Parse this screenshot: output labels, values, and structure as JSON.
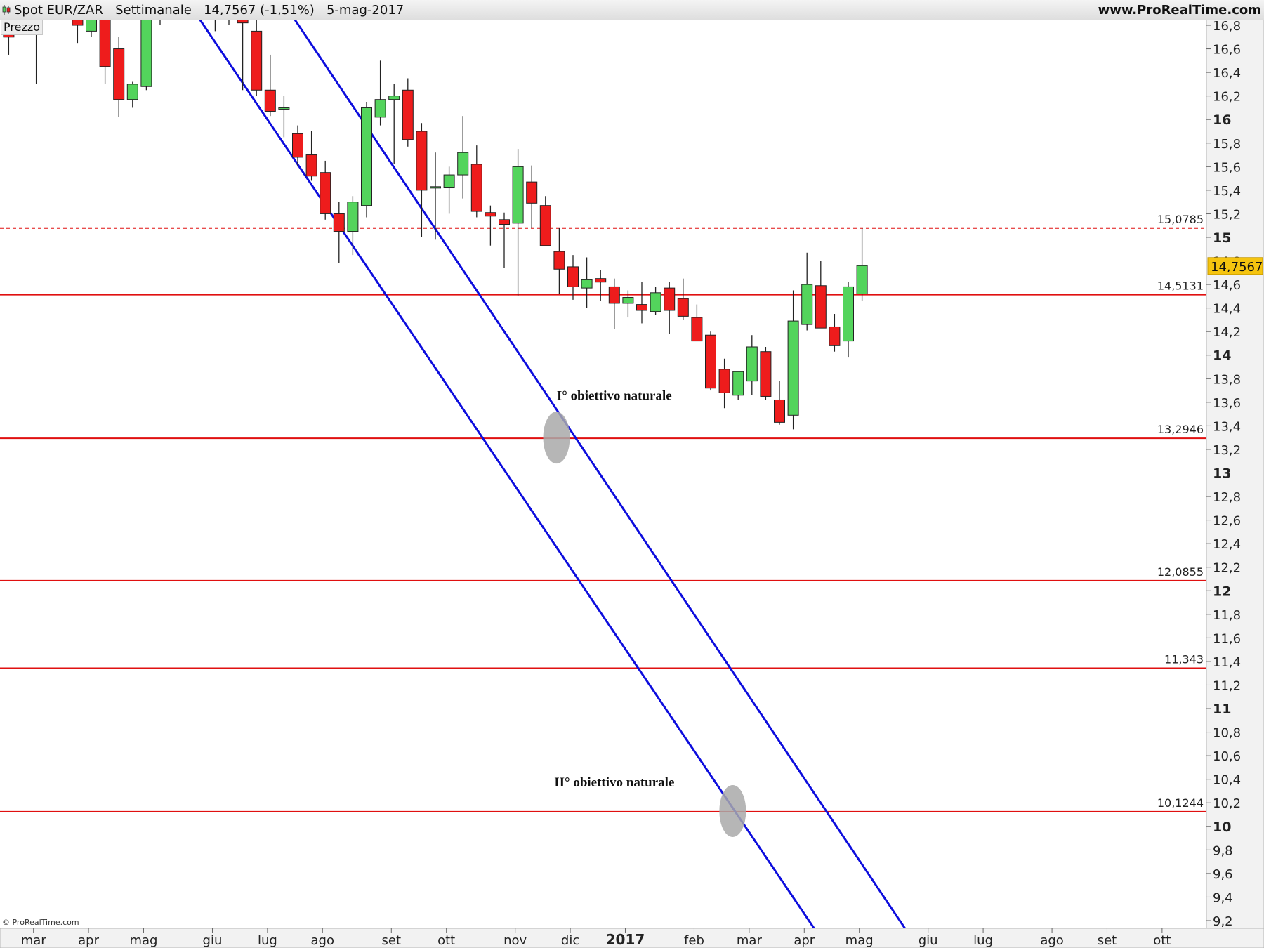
{
  "header": {
    "title": "Spot EUR/ZAR   Settimanale   14,7567 (-1,51%)   5-mag-2017",
    "site": "www.ProRealTime.com"
  },
  "panel": {
    "label": "Prezzo"
  },
  "footer": {
    "credit": "© ProRealTime.com"
  },
  "colors": {
    "up": "#53d45c",
    "down": "#ee1c1c",
    "trend": "#0d0ddd",
    "level": "#e01010",
    "target": "#a9a9a9",
    "price_tag": "#f5c40f",
    "axis_bg": "#f2f2f2"
  },
  "chart_data": {
    "type": "candlestick",
    "timeframe": "Settimanale",
    "ylim": [
      9.1,
      16.9
    ],
    "x_months": [
      {
        "label": "mar",
        "week": 1.8
      },
      {
        "label": "apr",
        "week": 5.8
      },
      {
        "label": "mag",
        "week": 9.8
      },
      {
        "label": "giu",
        "week": 14.8
      },
      {
        "label": "lug",
        "week": 18.8
      },
      {
        "label": "ago",
        "week": 22.8
      },
      {
        "label": "set",
        "week": 27.8
      },
      {
        "label": "ott",
        "week": 31.8
      },
      {
        "label": "nov",
        "week": 36.8
      },
      {
        "label": "dic",
        "week": 40.8
      },
      {
        "label": "2017",
        "week": 44.8,
        "bold": true
      },
      {
        "label": "feb",
        "week": 49.8
      },
      {
        "label": "mar",
        "week": 53.8
      },
      {
        "label": "apr",
        "week": 57.8
      },
      {
        "label": "mag",
        "week": 61.8
      },
      {
        "label": "giu",
        "week": 66.8
      },
      {
        "label": "lug",
        "week": 70.8
      },
      {
        "label": "ago",
        "week": 75.8
      },
      {
        "label": "set",
        "week": 79.8
      },
      {
        "label": "ott",
        "week": 83.8
      }
    ],
    "y_ticks": [
      "16,8",
      "16,6",
      "16,4",
      "16,2",
      "16",
      "15,8",
      "15,6",
      "15,4",
      "15,2",
      "15",
      "14,8",
      "14,6",
      "14,4",
      "14,2",
      "14",
      "13,8",
      "13,6",
      "13,4",
      "13,2",
      "13",
      "12,8",
      "12,6",
      "12,4",
      "12,2",
      "12",
      "11,8",
      "11,6",
      "11,4",
      "11,2",
      "11",
      "10,8",
      "10,6",
      "10,4",
      "10,2",
      "10",
      "9,8",
      "9,6",
      "9,4",
      "9,2"
    ],
    "y_ticks_bold": [
      "16",
      "15",
      "14",
      "13",
      "12",
      "11",
      "10"
    ],
    "candles": [
      {
        "w": 0,
        "o": 16.75,
        "h": 16.9,
        "l": 16.55,
        "c": 16.7
      },
      {
        "w": 2,
        "o": 16.8,
        "h": 16.9,
        "l": 16.3,
        "c": 16.85
      },
      {
        "w": 5,
        "o": 16.9,
        "h": 16.95,
        "l": 16.65,
        "c": 16.8
      },
      {
        "w": 6,
        "o": 16.75,
        "h": 16.92,
        "l": 16.7,
        "c": 16.9
      },
      {
        "w": 7,
        "o": 16.9,
        "h": 16.95,
        "l": 16.3,
        "c": 16.45
      },
      {
        "w": 8,
        "o": 16.6,
        "h": 16.7,
        "l": 16.02,
        "c": 16.17
      },
      {
        "w": 9,
        "o": 16.17,
        "h": 16.32,
        "l": 16.1,
        "c": 16.3
      },
      {
        "w": 10,
        "o": 16.28,
        "h": 16.95,
        "l": 16.25,
        "c": 16.9
      },
      {
        "w": 11,
        "o": 16.9,
        "h": 16.95,
        "l": 16.8,
        "c": 16.92
      },
      {
        "w": 15,
        "o": 16.9,
        "h": 16.95,
        "l": 16.75,
        "c": 16.92
      },
      {
        "w": 16,
        "o": 16.85,
        "h": 16.95,
        "l": 16.8,
        "c": 16.9
      },
      {
        "w": 17,
        "o": 16.95,
        "h": 16.95,
        "l": 16.25,
        "c": 16.82
      },
      {
        "w": 18,
        "o": 16.75,
        "h": 16.85,
        "l": 16.2,
        "c": 16.25
      },
      {
        "w": 19,
        "o": 16.25,
        "h": 16.55,
        "l": 16.03,
        "c": 16.07
      },
      {
        "w": 20,
        "o": 16.1,
        "h": 16.2,
        "l": 15.85,
        "c": 16.1
      },
      {
        "w": 21,
        "o": 15.88,
        "h": 15.95,
        "l": 15.6,
        "c": 15.68
      },
      {
        "w": 22,
        "o": 15.7,
        "h": 15.9,
        "l": 15.48,
        "c": 15.52
      },
      {
        "w": 23,
        "o": 15.55,
        "h": 15.65,
        "l": 15.15,
        "c": 15.2
      },
      {
        "w": 24,
        "o": 15.2,
        "h": 15.3,
        "l": 14.78,
        "c": 15.05
      },
      {
        "w": 25,
        "o": 15.05,
        "h": 15.35,
        "l": 14.85,
        "c": 15.3
      },
      {
        "w": 26,
        "o": 15.27,
        "h": 16.15,
        "l": 15.17,
        "c": 16.1
      },
      {
        "w": 27,
        "o": 16.02,
        "h": 16.5,
        "l": 15.95,
        "c": 16.17
      },
      {
        "w": 28,
        "o": 16.17,
        "h": 16.3,
        "l": 15.62,
        "c": 16.2
      },
      {
        "w": 29,
        "o": 16.25,
        "h": 16.35,
        "l": 15.77,
        "c": 15.83
      },
      {
        "w": 30,
        "o": 15.9,
        "h": 15.97,
        "l": 15.0,
        "c": 15.4
      },
      {
        "w": 31,
        "o": 15.43,
        "h": 15.72,
        "l": 14.98,
        "c": 15.43
      },
      {
        "w": 32,
        "o": 15.42,
        "h": 15.6,
        "l": 15.2,
        "c": 15.53
      },
      {
        "w": 33,
        "o": 15.53,
        "h": 16.03,
        "l": 15.33,
        "c": 15.72
      },
      {
        "w": 34,
        "o": 15.62,
        "h": 15.78,
        "l": 15.17,
        "c": 15.22
      },
      {
        "w": 35,
        "o": 15.21,
        "h": 15.27,
        "l": 14.93,
        "c": 15.18
      },
      {
        "w": 36,
        "o": 15.15,
        "h": 15.21,
        "l": 14.74,
        "c": 15.11
      },
      {
        "w": 37,
        "o": 15.12,
        "h": 15.75,
        "l": 14.5,
        "c": 15.6
      },
      {
        "w": 38,
        "o": 15.47,
        "h": 15.61,
        "l": 15.08,
        "c": 15.29
      },
      {
        "w": 39,
        "o": 15.27,
        "h": 15.35,
        "l": 14.95,
        "c": 14.93
      },
      {
        "w": 40,
        "o": 14.88,
        "h": 15.08,
        "l": 14.52,
        "c": 14.73
      },
      {
        "w": 41,
        "o": 14.75,
        "h": 14.85,
        "l": 14.47,
        "c": 14.58
      },
      {
        "w": 42,
        "o": 14.57,
        "h": 14.83,
        "l": 14.4,
        "c": 14.64
      },
      {
        "w": 43,
        "o": 14.65,
        "h": 14.72,
        "l": 14.46,
        "c": 14.62
      },
      {
        "w": 44,
        "o": 14.58,
        "h": 14.65,
        "l": 14.22,
        "c": 14.44
      },
      {
        "w": 45,
        "o": 14.44,
        "h": 14.55,
        "l": 14.32,
        "c": 14.49
      },
      {
        "w": 46,
        "o": 14.43,
        "h": 14.62,
        "l": 14.27,
        "c": 14.38
      },
      {
        "w": 47,
        "o": 14.37,
        "h": 14.58,
        "l": 14.34,
        "c": 14.53
      },
      {
        "w": 48,
        "o": 14.57,
        "h": 14.62,
        "l": 14.18,
        "c": 14.38
      },
      {
        "w": 49,
        "o": 14.48,
        "h": 14.65,
        "l": 14.3,
        "c": 14.33
      },
      {
        "w": 50,
        "o": 14.32,
        "h": 14.43,
        "l": 14.14,
        "c": 14.12
      },
      {
        "w": 51,
        "o": 14.17,
        "h": 14.2,
        "l": 13.7,
        "c": 13.72
      },
      {
        "w": 52,
        "o": 13.88,
        "h": 13.97,
        "l": 13.55,
        "c": 13.68
      },
      {
        "w": 53,
        "o": 13.66,
        "h": 13.86,
        "l": 13.62,
        "c": 13.86
      },
      {
        "w": 54,
        "o": 13.78,
        "h": 14.17,
        "l": 13.66,
        "c": 14.07
      },
      {
        "w": 55,
        "o": 14.03,
        "h": 14.07,
        "l": 13.62,
        "c": 13.65
      },
      {
        "w": 56,
        "o": 13.62,
        "h": 13.78,
        "l": 13.41,
        "c": 13.43
      },
      {
        "w": 57,
        "o": 13.49,
        "h": 14.55,
        "l": 13.37,
        "c": 14.29
      },
      {
        "w": 58,
        "o": 14.26,
        "h": 14.87,
        "l": 14.21,
        "c": 14.6
      },
      {
        "w": 59,
        "o": 14.59,
        "h": 14.8,
        "l": 14.23,
        "c": 14.23
      },
      {
        "w": 60,
        "o": 14.24,
        "h": 14.35,
        "l": 14.03,
        "c": 14.08
      },
      {
        "w": 61,
        "o": 14.12,
        "h": 14.62,
        "l": 13.98,
        "c": 14.58
      },
      {
        "w": 62,
        "o": 14.52,
        "h": 15.08,
        "l": 14.46,
        "c": 14.76
      }
    ],
    "levels": [
      {
        "value": 15.0785,
        "label": "15,0785",
        "style": "dashed"
      },
      {
        "value": 14.5131,
        "label": "14,5131",
        "style": "solid"
      },
      {
        "value": 13.2946,
        "label": "13,2946",
        "style": "solid"
      },
      {
        "value": 12.0855,
        "label": "12,0855",
        "style": "solid"
      },
      {
        "value": 11.343,
        "label": "11,343",
        "style": "solid"
      },
      {
        "value": 10.1244,
        "label": "10,1244",
        "style": "solid"
      }
    ],
    "trend_lines": [
      {
        "p1": {
          "w": 13.3,
          "y": 16.95
        },
        "p2": {
          "w": 58.6,
          "y": 9.12
        }
      },
      {
        "p1": {
          "w": 20.2,
          "y": 16.95
        },
        "p2": {
          "w": 65.2,
          "y": 9.12
        }
      }
    ],
    "targets": [
      {
        "w": 39.8,
        "y": 13.3
      },
      {
        "w": 52.6,
        "y": 10.13
      }
    ],
    "annotations": [
      {
        "text": "I° obiettivo naturale",
        "w": 44,
        "y": 13.62
      },
      {
        "text": "II° obiettivo naturale",
        "w": 44,
        "y": 10.34
      }
    ],
    "last_price": {
      "value": 14.7567,
      "label": "14,7567"
    }
  }
}
